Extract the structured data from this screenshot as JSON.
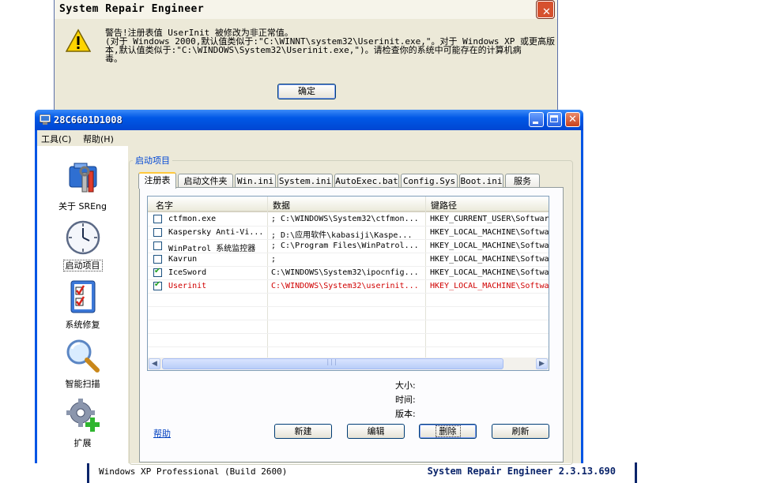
{
  "dialog": {
    "title": "System Repair Engineer",
    "close": "✕",
    "message": "警告!注册表值 UserInit 被修改为非正常值。\n(对于 Windows 2000,默认值类似于:\"C:\\WINNT\\system32\\Userinit.exe,\"。对于 Windows XP 或更高版\n本,默认值类似于:\"C:\\WINDOWS\\System32\\Userinit.exe,\")。请检查你的系统中可能存在的计算机病\n毒。",
    "ok": "确定"
  },
  "window": {
    "title": "28C6601D1008"
  },
  "menu": {
    "tools": "工具(C)",
    "help": "帮助(H)"
  },
  "sidebar": {
    "items": [
      {
        "label": "关于 SREng",
        "icon": "toolbox-icon"
      },
      {
        "label": "启动项目",
        "icon": "clock-icon"
      },
      {
        "label": "系统修复",
        "icon": "checklist-icon"
      },
      {
        "label": "智能扫描",
        "icon": "magnifier-icon"
      },
      {
        "label": "扩展",
        "icon": "gear-plus-icon"
      }
    ]
  },
  "group_title": "启动项目",
  "tabs": [
    "注册表",
    "启动文件夹",
    "Win.ini",
    "System.ini",
    "AutoExec.bat",
    "Config.Sys",
    "Boot.ini",
    "服务"
  ],
  "list": {
    "columns": [
      "名字",
      "数据",
      "键路径"
    ],
    "rows": [
      {
        "checked": false,
        "name": "ctfmon.exe",
        "data": "; C:\\WINDOWS\\System32\\ctfmon...",
        "path": "HKEY_CURRENT_USER\\Softwar"
      },
      {
        "checked": false,
        "name": "Kaspersky Anti-Vi...",
        "data": "; D:\\应用软件\\kabasiji\\Kaspe...",
        "path": "HKEY_LOCAL_MACHINE\\Softwa"
      },
      {
        "checked": false,
        "name": "WinPatrol 系统监控器",
        "data": "; C:\\Program Files\\WinPatrol...",
        "path": "HKEY_LOCAL_MACHINE\\Softwa"
      },
      {
        "checked": false,
        "name": "Kavrun",
        "data": ";",
        "path": "HKEY_LOCAL_MACHINE\\Softwa"
      },
      {
        "checked": true,
        "name": "IceSword",
        "data": "C:\\WINDOWS\\System32\\ipocnfig...",
        "path": "HKEY_LOCAL_MACHINE\\Softwa"
      },
      {
        "checked": true,
        "name": "Userinit",
        "data": "C:\\WINDOWS\\System32\\userinit...",
        "path": "HKEY_LOCAL_MACHINE\\Softwa",
        "highlight": true
      }
    ]
  },
  "info": {
    "size": "大小:",
    "time": "时间:",
    "version": "版本:"
  },
  "help_link": "帮助",
  "buttons": {
    "new": "新建",
    "edit": "编辑",
    "delete": "删除",
    "refresh": "刷新"
  },
  "back_window": {
    "os": "Windows XP Professional  (Build 2600)",
    "product": "System Repair Engineer 2.3.13.690"
  },
  "colors": {
    "xp_blue": "#0055e5",
    "link": "#0040c0",
    "warning": "#d00000",
    "group_title": "#0046d5"
  }
}
